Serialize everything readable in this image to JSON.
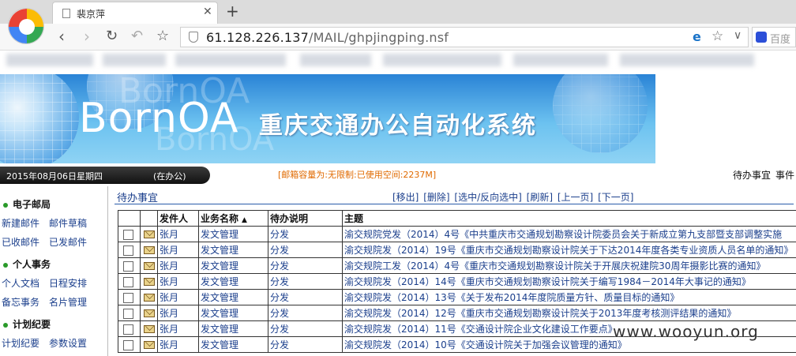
{
  "browser": {
    "tab_title": "裴京萍",
    "url_host": "61.128.226.137",
    "url_path": "/MAIL/ghpjingping.nsf",
    "search_placeholder": "百度"
  },
  "banner": {
    "logo": "BornOA",
    "title": "重庆交通办公自动化系统"
  },
  "infobar": {
    "date": "2015年08月06日星期四",
    "status": "(在办公)",
    "mailbox": "[邮箱容量为:无限制:已使用空间:2237M]",
    "topnav": [
      "待办事宜",
      "事件"
    ]
  },
  "sidebar": {
    "sections": [
      {
        "title": "电子邮局",
        "links": [
          "新建邮件",
          "邮件草稿",
          "已收邮件",
          "已发邮件"
        ]
      },
      {
        "title": "个人事务",
        "links": [
          "个人文档",
          "日程安排",
          "备忘事务",
          "名片管理"
        ]
      },
      {
        "title": "计划纪要",
        "links": [
          "计划纪要",
          "参数设置"
        ]
      }
    ]
  },
  "main": {
    "title": "待办事宜",
    "actions": [
      "[移出]",
      "[删除]",
      "[选中/反向选中]",
      "[刷新]",
      "[上一页]",
      "[下一页]"
    ],
    "columns": [
      "发件人",
      "业务名称",
      "待办说明",
      "主题"
    ],
    "rows": [
      {
        "sender": "张月",
        "business": "发文管理",
        "note": "分发",
        "subject": "渝交规院党发（2014）4号《中共重庆市交通规划勘察设计院委员会关于新成立第九支部暨支部调整实施"
      },
      {
        "sender": "张月",
        "business": "发文管理",
        "note": "分发",
        "subject": "渝交规院发（2014）19号《重庆市交通规划勘察设计院关于下达2014年度各类专业资质人员名单的通知》"
      },
      {
        "sender": "张月",
        "business": "发文管理",
        "note": "分发",
        "subject": "渝交规院工发（2014）4号《重庆市交通规划勘察设计院关于开展庆祝建院30周年摄影比赛的通知》"
      },
      {
        "sender": "张月",
        "business": "发文管理",
        "note": "分发",
        "subject": "渝交规院发（2014）14号《重庆市交通规划勘察设计院关于编写1984－2014年大事记的通知》"
      },
      {
        "sender": "张月",
        "business": "发文管理",
        "note": "分发",
        "subject": "渝交规院发（2014）13号《关于发布2014年度院质量方针、质量目标的通知》"
      },
      {
        "sender": "张月",
        "business": "发文管理",
        "note": "分发",
        "subject": "渝交规院发（2014）12号《重庆市交通规划勘察设计院关于2013年度考核测评结果的通知》"
      },
      {
        "sender": "张月",
        "business": "发文管理",
        "note": "分发",
        "subject": "渝交规院发（2014）11号《交通设计院企业文化建设工作要点》"
      },
      {
        "sender": "张月",
        "business": "发文管理",
        "note": "分发",
        "subject": "渝交规院发（2014）10号《交通设计院关于加强会议管理的通知》"
      }
    ]
  },
  "watermark": "www.wooyun.org",
  "colors": {
    "link": "#1b3f8c",
    "mailbox": "#e06a00",
    "banner": "#2a83d6"
  }
}
